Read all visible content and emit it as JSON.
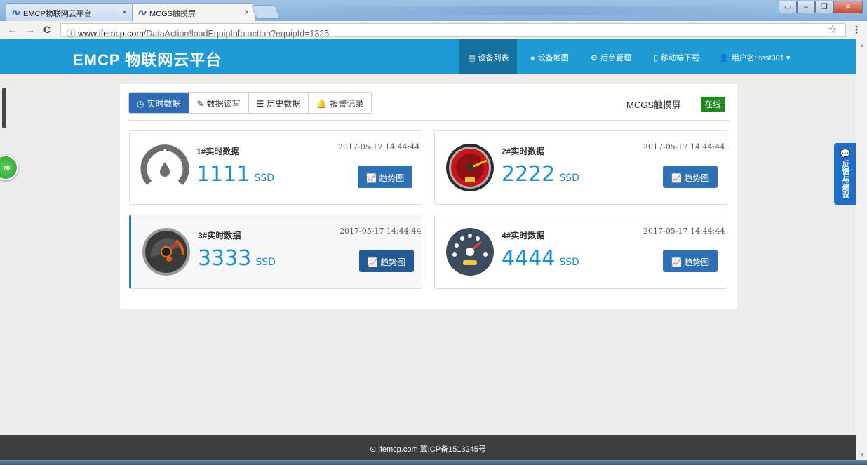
{
  "browser": {
    "tabs": [
      {
        "title": "EMCP物联网云平台",
        "close": "×"
      },
      {
        "title": "MCGS触摸屏",
        "close": "×"
      }
    ],
    "window_buttons": [
      "▭",
      "–",
      "❐",
      "✕"
    ],
    "url_domain": "www.lfemcp.com",
    "url_path": "/DataAction!loadEquipInfo.action?equipId=1325"
  },
  "navbar": {
    "logo": "EMCP 物联网云平台",
    "items": [
      {
        "icon": "list-icon",
        "label": "设备列表"
      },
      {
        "icon": "globe-icon",
        "label": "设备地图"
      },
      {
        "icon": "gears-icon",
        "label": "后台管理"
      },
      {
        "icon": "mobile-icon",
        "label": "移动端下载"
      },
      {
        "icon": "user-icon",
        "label": "用户名: test001"
      }
    ]
  },
  "side_badge": "78",
  "feedback": "反馈与建议",
  "panel": {
    "tabs": [
      {
        "icon": "clock-icon",
        "label": "实时数据"
      },
      {
        "icon": "pencil-icon",
        "label": "数据读写"
      },
      {
        "icon": "list-icon",
        "label": "历史数据"
      },
      {
        "icon": "bell-icon",
        "label": "报警记录"
      }
    ],
    "device_name": "MCGS触摸屏",
    "status": "在线"
  },
  "cards": [
    {
      "name": "1#实时数据",
      "time": "2017-05-17 14:44:44",
      "value": "1111",
      "unit": "SSD",
      "button": "趋势图",
      "gauge": "droplet-gauge-icon"
    },
    {
      "name": "2#实时数据",
      "time": "2017-05-17 14:44:44",
      "value": "2222",
      "unit": "SSD",
      "button": "趋势图",
      "gauge": "red-speedometer-icon"
    },
    {
      "name": "3#实时数据",
      "time": "2017-05-17 14:44:44",
      "value": "3333",
      "unit": "SSD",
      "button": "趋势图",
      "gauge": "dark-speedometer-icon"
    },
    {
      "name": "4#实时数据",
      "time": "2017-05-17 14:44:44",
      "value": "4444",
      "unit": "SSD",
      "button": "趋势图",
      "gauge": "dashboard-gauge-icon"
    }
  ],
  "footer": "lfemcp.com 冀ICP备1513245号",
  "colors": {
    "navbar": "#1e9bd4",
    "active_tab": "#2f6cb5",
    "value": "#1d8fd1",
    "online": "#1f8a1f",
    "footer": "#3e3e3e"
  }
}
